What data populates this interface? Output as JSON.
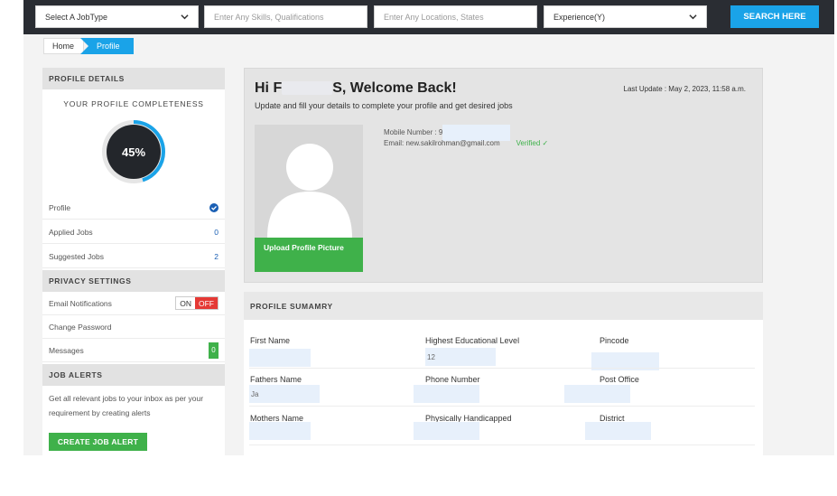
{
  "search": {
    "jobtype_value": "Select A JobType",
    "skills_placeholder": "Enter Any Skills, Qualifications",
    "location_placeholder": "Enter Any Locations, States",
    "experience_value": "Experience(Y)",
    "button_label": "SEARCH HERE"
  },
  "breadcrumb": {
    "home": "Home",
    "current": "Profile"
  },
  "sidebar": {
    "profile_details_heading": "PROFILE DETAILS",
    "completeness_title": "YOUR PROFILE COMPLETENESS",
    "completeness_value": 45,
    "completeness_label": "45%",
    "items": [
      {
        "label": "Profile",
        "value": ""
      },
      {
        "label": "Applied Jobs",
        "value": "0"
      },
      {
        "label": "Suggested Jobs",
        "value": "2"
      }
    ],
    "privacy_heading": "PRIVACY SETTINGS",
    "email_notifications": {
      "label": "Email Notifications",
      "on": "ON",
      "off": "OFF"
    },
    "change_password": "Change Password",
    "messages": {
      "label": "Messages",
      "count": "0"
    },
    "job_alerts_heading": "JOB ALERTS",
    "job_alerts_text": "Get all relevant jobs to your inbox as per your requirement by creating alerts",
    "create_alert_button": "CREATE JOB ALERT"
  },
  "welcome": {
    "greeting_prefix": "Hi F",
    "greeting_suffix": "S, Welcome Back!",
    "subtitle": "Update and fill your details to complete your profile and get desired jobs",
    "last_update": "Last Update : May 2, 2023, 11:58 a.m.",
    "upload_button": "Upload Profile Picture",
    "mobile_label": "Mobile Number : 9",
    "email_label": "Email: new.sakilrohman@gmail.com",
    "verified": "Verified ✓"
  },
  "summary": {
    "heading": "PROFILE SUMAMRY",
    "fields": [
      {
        "label": "First Name",
        "value": ""
      },
      {
        "label": "Highest Educational Level",
        "value": "12"
      },
      {
        "label": "Pincode",
        "value": ""
      },
      {
        "label": "Fathers Name",
        "value": "Ja"
      },
      {
        "label": "Phone Number",
        "value": ""
      },
      {
        "label": "Post Office",
        "value": ""
      },
      {
        "label": "Mothers Name",
        "value": ""
      },
      {
        "label": "Physically Handicapped",
        "value": ""
      },
      {
        "label": "District",
        "value": ""
      }
    ]
  },
  "colors": {
    "accent": "#1aa3e8",
    "success": "#3fb14a",
    "danger": "#e53935",
    "topbar": "#2a2d33"
  }
}
